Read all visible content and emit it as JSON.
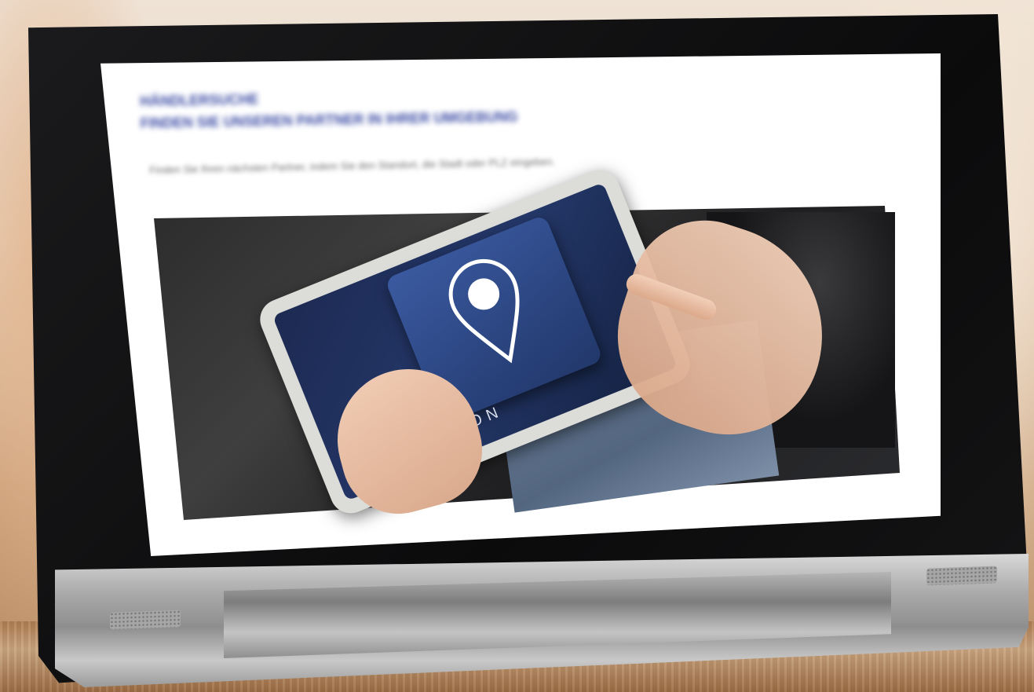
{
  "scene": {
    "description_label": "tablet-on-table"
  },
  "screen": {
    "heading_line1": "HÄNDLERSUCHE",
    "heading_line2": "FINDEN SIE UNSEREN PARTNER IN IHRER UMGEBUNG",
    "body_text": "Finden Sie Ihren nächsten Partner, indem Sie den Standort, die Stadt oder PLZ eingeben."
  },
  "photo": {
    "location_label": "LOCATION"
  },
  "colors": {
    "heading": "#3a4aa3",
    "pin_card": "#2b4580",
    "bezel": "#0b0b0c"
  }
}
